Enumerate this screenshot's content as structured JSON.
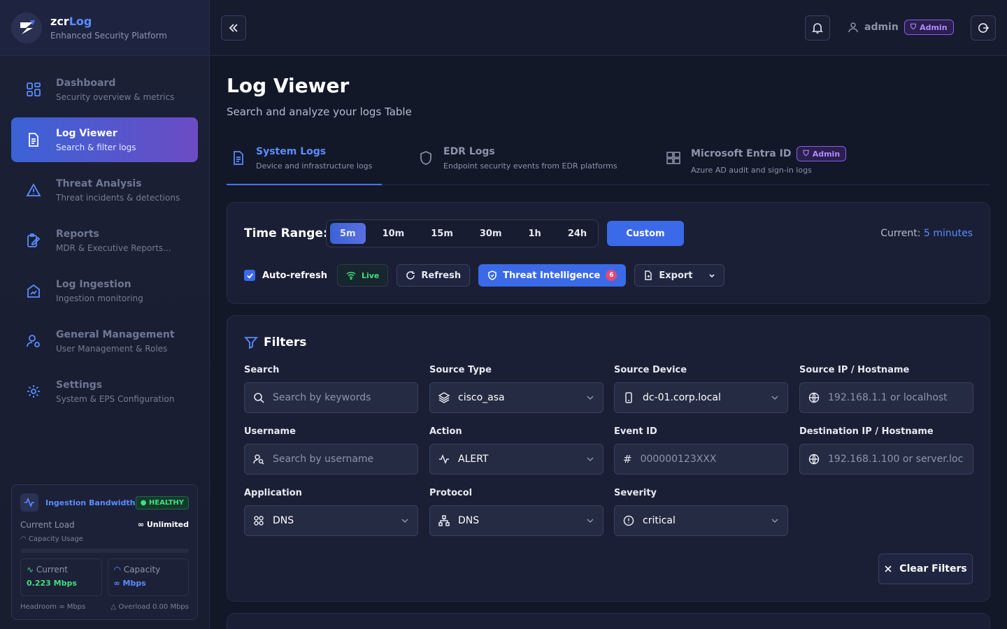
{
  "brand": {
    "name_main": "zcr",
    "name_accent": "Log",
    "subtitle": "Enhanced Security Platform"
  },
  "sidebar": {
    "items": [
      {
        "title": "Dashboard",
        "sub": "Security overview & metrics",
        "icon": "grid-icon"
      },
      {
        "title": "Log Viewer",
        "sub": "Search & filter logs",
        "icon": "document-icon",
        "active": true
      },
      {
        "title": "Threat Analysis",
        "sub": "Threat incidents & detections",
        "icon": "warning-icon"
      },
      {
        "title": "Reports",
        "sub": "MDR & Executive Reports...",
        "icon": "report-edit-icon"
      },
      {
        "title": "Log Ingestion",
        "sub": "Ingestion monitoring",
        "icon": "ingestion-icon"
      },
      {
        "title": "General Management",
        "sub": "User Management & Roles",
        "icon": "user-settings-icon"
      },
      {
        "title": "Settings",
        "sub": "System & EPS Configuration",
        "icon": "gear-icon"
      }
    ],
    "bandwidth": {
      "title": "Ingestion Bandwidth",
      "status": "HEALTHY",
      "current_load_label": "Current Load",
      "current_load_value": "∞ Unlimited",
      "capacity_usage_label": "Capacity Usage",
      "current_label": "Current",
      "current_value": "0.223 Mbps",
      "capacity_label": "Capacity",
      "capacity_value": "∞ Mbps",
      "headroom": "Headroom ∞ Mbps",
      "overload": "Overload 0.00 Mbps"
    }
  },
  "topbar": {
    "username": "admin",
    "role_badge": "Admin"
  },
  "page": {
    "title": "Log Viewer",
    "subtitle": "Search and analyze your logs Table"
  },
  "tabs": [
    {
      "title": "System Logs",
      "sub": "Device and infrastructure logs"
    },
    {
      "title": "EDR Logs",
      "sub": "Endpoint security events from EDR platforms"
    },
    {
      "title": "Microsoft Entra ID",
      "sub": "Azure AD audit and sign-in logs",
      "badge": "Admin"
    }
  ],
  "time_range": {
    "label": "Time Range:",
    "options": [
      "5m",
      "10m",
      "15m",
      "30m",
      "1h",
      "24h"
    ],
    "selected": "5m",
    "custom_label": "Custom",
    "current_prefix": "Current:",
    "current_value": "5 minutes"
  },
  "controls": {
    "auto_refresh": "Auto-refresh",
    "live": "Live",
    "refresh": "Refresh",
    "threat_intel": "Threat Intelligence",
    "threat_count": "6",
    "export": "Export"
  },
  "filters": {
    "title": "Filters",
    "search": {
      "label": "Search",
      "placeholder": "Search by keywords"
    },
    "source_type": {
      "label": "Source Type",
      "value": "cisco_asa"
    },
    "source_device": {
      "label": "Source Device",
      "value": "dc-01.corp.local"
    },
    "source_ip": {
      "label": "Source IP / Hostname",
      "placeholder": "192.168.1.1 or localhost"
    },
    "username": {
      "label": "Username",
      "placeholder": "Search by username"
    },
    "action": {
      "label": "Action",
      "value": "ALERT"
    },
    "event_id": {
      "label": "Event ID",
      "placeholder": "000000123XXX"
    },
    "dest_ip": {
      "label": "Destination IP / Hostname",
      "placeholder": "192.168.1.100 or server.loc"
    },
    "application": {
      "label": "Application",
      "value": "DNS"
    },
    "protocol": {
      "label": "Protocol",
      "value": "DNS"
    },
    "severity": {
      "label": "Severity",
      "value": "critical"
    },
    "clear": "Clear Filters"
  },
  "colors": {
    "accent": "#5b8cff",
    "primary": "#3b6ae8",
    "healthy": "#3fe07d",
    "admin": "#8a5cf0"
  }
}
